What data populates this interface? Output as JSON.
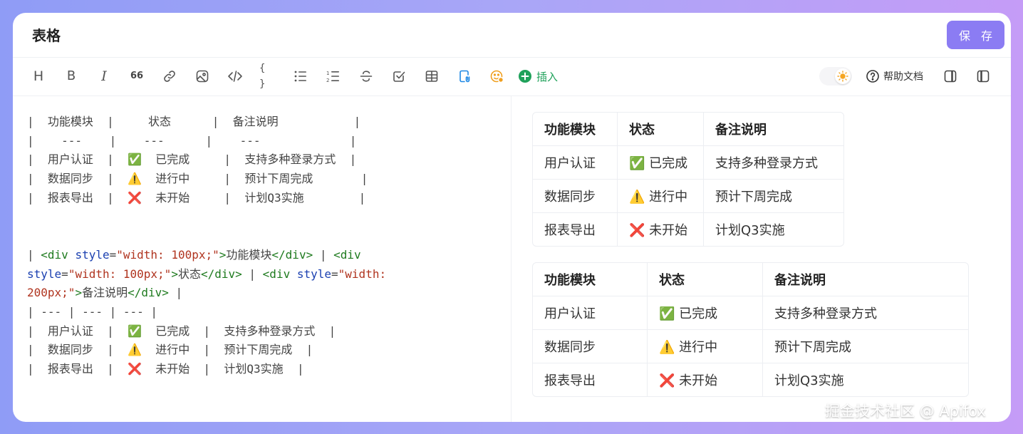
{
  "header": {
    "title": "表格",
    "save_label": "保 存"
  },
  "toolbar": {
    "icons": [
      "heading-icon",
      "bold-icon",
      "italic-icon",
      "quote-icon",
      "link-icon",
      "image-icon",
      "code-icon",
      "code-block-icon",
      "bullet-list-icon",
      "ordered-list-icon",
      "strikethrough-icon",
      "task-list-icon",
      "table-icon",
      "file-attach-icon",
      "emoji-icon"
    ],
    "heading_glyph": "H",
    "bold_glyph": "B",
    "italic_glyph": "I",
    "quote_glyph": "66",
    "code_block_glyph": "{ }",
    "insert_label": "插入",
    "help_label": "帮助文档",
    "accent_color": "#1fa15a"
  },
  "editor": {
    "lines1": [
      "|  功能模块  |     状态      |  备注说明           |",
      "|    ---    |    ---      |    ---             |",
      "|  用户认证  |  ✅  已完成     |  支持多种登录方式  |",
      "|  数据同步  |  ⚠️  进行中     |  预计下周完成       |",
      "|  报表导出  |  ❌  未开始     |  计划Q3实施        |"
    ],
    "html_line": {
      "p1": "| ",
      "tag1": "<div ",
      "attr": "style",
      "eq": "=",
      "str1": "\"width: 100px;\"",
      "close1": ">",
      "text1": "功能模块",
      "end1": "</div>",
      "sep1": " | ",
      "str2": "\"width: 100px;\"",
      "text2": "状态",
      "str3": "\"width: 200px;\"",
      "text3": "备注说明",
      "p_end": " |"
    },
    "lines2": [
      "| --- | --- | --- |",
      "|  用户认证  |  ✅  已完成  |  支持多种登录方式  |",
      "|  数据同步  |  ⚠️  进行中  |  预计下周完成  |",
      "|  报表导出  |  ❌  未开始  |  计划Q3实施  |"
    ]
  },
  "preview": {
    "table1": {
      "headers": [
        "功能模块",
        "状态",
        "备注说明"
      ],
      "rows": [
        [
          "用户认证",
          "✅ 已完成",
          "支持多种登录方式"
        ],
        [
          "数据同步",
          "⚠️ 进行中",
          "预计下周完成"
        ],
        [
          "报表导出",
          "❌ 未开始",
          "计划Q3实施"
        ]
      ]
    },
    "table2": {
      "headers": [
        "功能模块",
        "状态",
        "备注说明"
      ],
      "rows": [
        [
          "用户认证",
          "✅ 已完成",
          "支持多种登录方式"
        ],
        [
          "数据同步",
          "⚠️ 进行中",
          "预计下周完成"
        ],
        [
          "报表导出",
          "❌ 未开始",
          "计划Q3实施"
        ]
      ]
    }
  },
  "watermark": "掘金技术社区 @ Apifox"
}
